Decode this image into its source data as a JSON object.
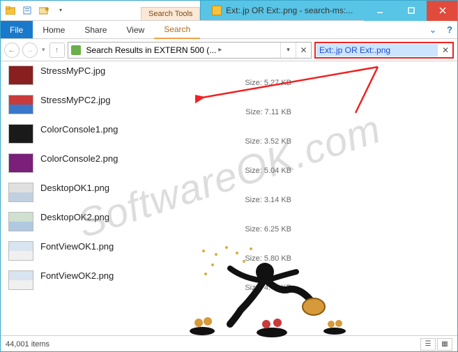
{
  "titlebar": {
    "context_tab": "Search Tools",
    "title": "Ext:.jp OR Ext:.png - search-ms:..."
  },
  "ribbon": {
    "file": "File",
    "tabs": [
      "Home",
      "Share",
      "View"
    ],
    "search_tab": "Search"
  },
  "nav": {
    "breadcrumb": "Search Results in EXTERN 500 (...",
    "breadcrumb_sep": "▸",
    "search_value": "Ext:.jp OR Ext:.png"
  },
  "files": [
    {
      "name": "StressMyPC.jpg",
      "size": "Size: 5.27 KB",
      "c1": "#8a1f1f",
      "c2": "#8a1f1f"
    },
    {
      "name": "StressMyPC2.jpg",
      "size": "Size: 7.11 KB",
      "c1": "#c93a3a",
      "c2": "#3a77c9"
    },
    {
      "name": "ColorConsole1.png",
      "size": "Size: 3.52 KB",
      "c1": "#1a1a1a",
      "c2": "#1a1a1a"
    },
    {
      "name": "ColorConsole2.png",
      "size": "Size: 5.04 KB",
      "c1": "#7a1f7a",
      "c2": "#7a1f7a"
    },
    {
      "name": "DesktopOK1.png",
      "size": "Size: 3.14 KB",
      "c1": "#e0e0e0",
      "c2": "#c0d0e0"
    },
    {
      "name": "DesktopOK2.png",
      "size": "Size: 6.25 KB",
      "c1": "#d0e0d0",
      "c2": "#b0c8e0"
    },
    {
      "name": "FontViewOK1.png",
      "size": "Size: 5.80 KB",
      "c1": "#d8e4f0",
      "c2": "#f0f0f0"
    },
    {
      "name": "FontViewOK2.png",
      "size": "Size: 4.46 KB",
      "c1": "#d8e4f0",
      "c2": "#f0f0f0"
    }
  ],
  "status": {
    "count": "44,001 items"
  },
  "watermark": "SoftwareOK.com"
}
